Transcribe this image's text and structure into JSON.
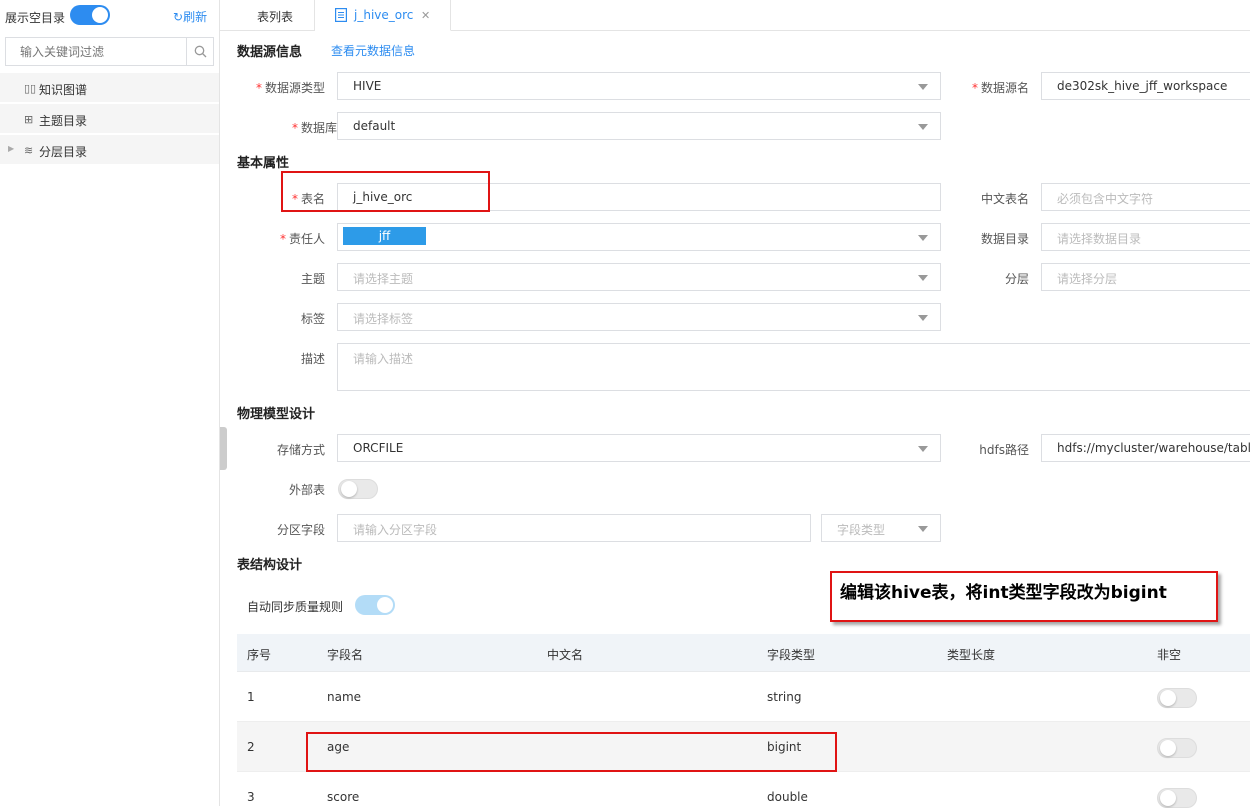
{
  "sidebar": {
    "show_empty_label": "展示空目录",
    "refresh_label": "刷新",
    "filter_placeholder": "输入关键词过滤",
    "items": [
      {
        "label": "知识图谱",
        "icon": "knowledge-graph-icon"
      },
      {
        "label": "主题目录",
        "icon": "grid-icon"
      },
      {
        "label": "分层目录",
        "icon": "layers-icon"
      }
    ]
  },
  "tabs": [
    {
      "label": "表列表"
    },
    {
      "label": "j_hive_orc"
    }
  ],
  "datasource": {
    "title": "数据源信息",
    "view_meta_link": "查看元数据信息",
    "type_label": "数据源类型",
    "type_value": "HIVE",
    "name_label": "数据源名",
    "name_value": "de302sk_hive_jff_workspace",
    "db_label": "数据库",
    "db_value": "default"
  },
  "basic": {
    "title": "基本属性",
    "table_name_label": "表名",
    "table_name_value": "j_hive_orc",
    "cn_name_label": "中文表名",
    "cn_name_placeholder": "必须包含中文字符",
    "owner_label": "责任人",
    "owner_tag": "jff",
    "data_dir_label": "数据目录",
    "data_dir_placeholder": "请选择数据目录",
    "topic_label": "主题",
    "topic_placeholder": "请选择主题",
    "layer_label": "分层",
    "layer_placeholder": "请选择分层",
    "tag_label": "标签",
    "tag_placeholder": "请选择标签",
    "desc_label": "描述",
    "desc_placeholder": "请输入描述"
  },
  "physical": {
    "title": "物理模型设计",
    "storage_label": "存储方式",
    "storage_value": "ORCFILE",
    "hdfs_label": "hdfs路径",
    "hdfs_value": "hdfs://mycluster/warehouse/table",
    "external_label": "外部表",
    "partition_label": "分区字段",
    "partition_placeholder": "请输入分区字段",
    "partition_type_placeholder": "字段类型"
  },
  "structure": {
    "title": "表结构设计",
    "auto_sync_label": "自动同步质量规则",
    "columns": [
      "序号",
      "字段名",
      "中文名",
      "字段类型",
      "类型长度",
      "非空"
    ],
    "rows": [
      {
        "idx": "1",
        "name": "name",
        "type": "string"
      },
      {
        "idx": "2",
        "name": "age",
        "type": "bigint"
      },
      {
        "idx": "3",
        "name": "score",
        "type": "double"
      }
    ]
  },
  "annotation": {
    "text": "编辑该hive表，将int类型字段改为bigint"
  },
  "colors": {
    "accent": "#2d8cf0",
    "tag": "#2d9be8",
    "annotation_border": "#e01414"
  }
}
